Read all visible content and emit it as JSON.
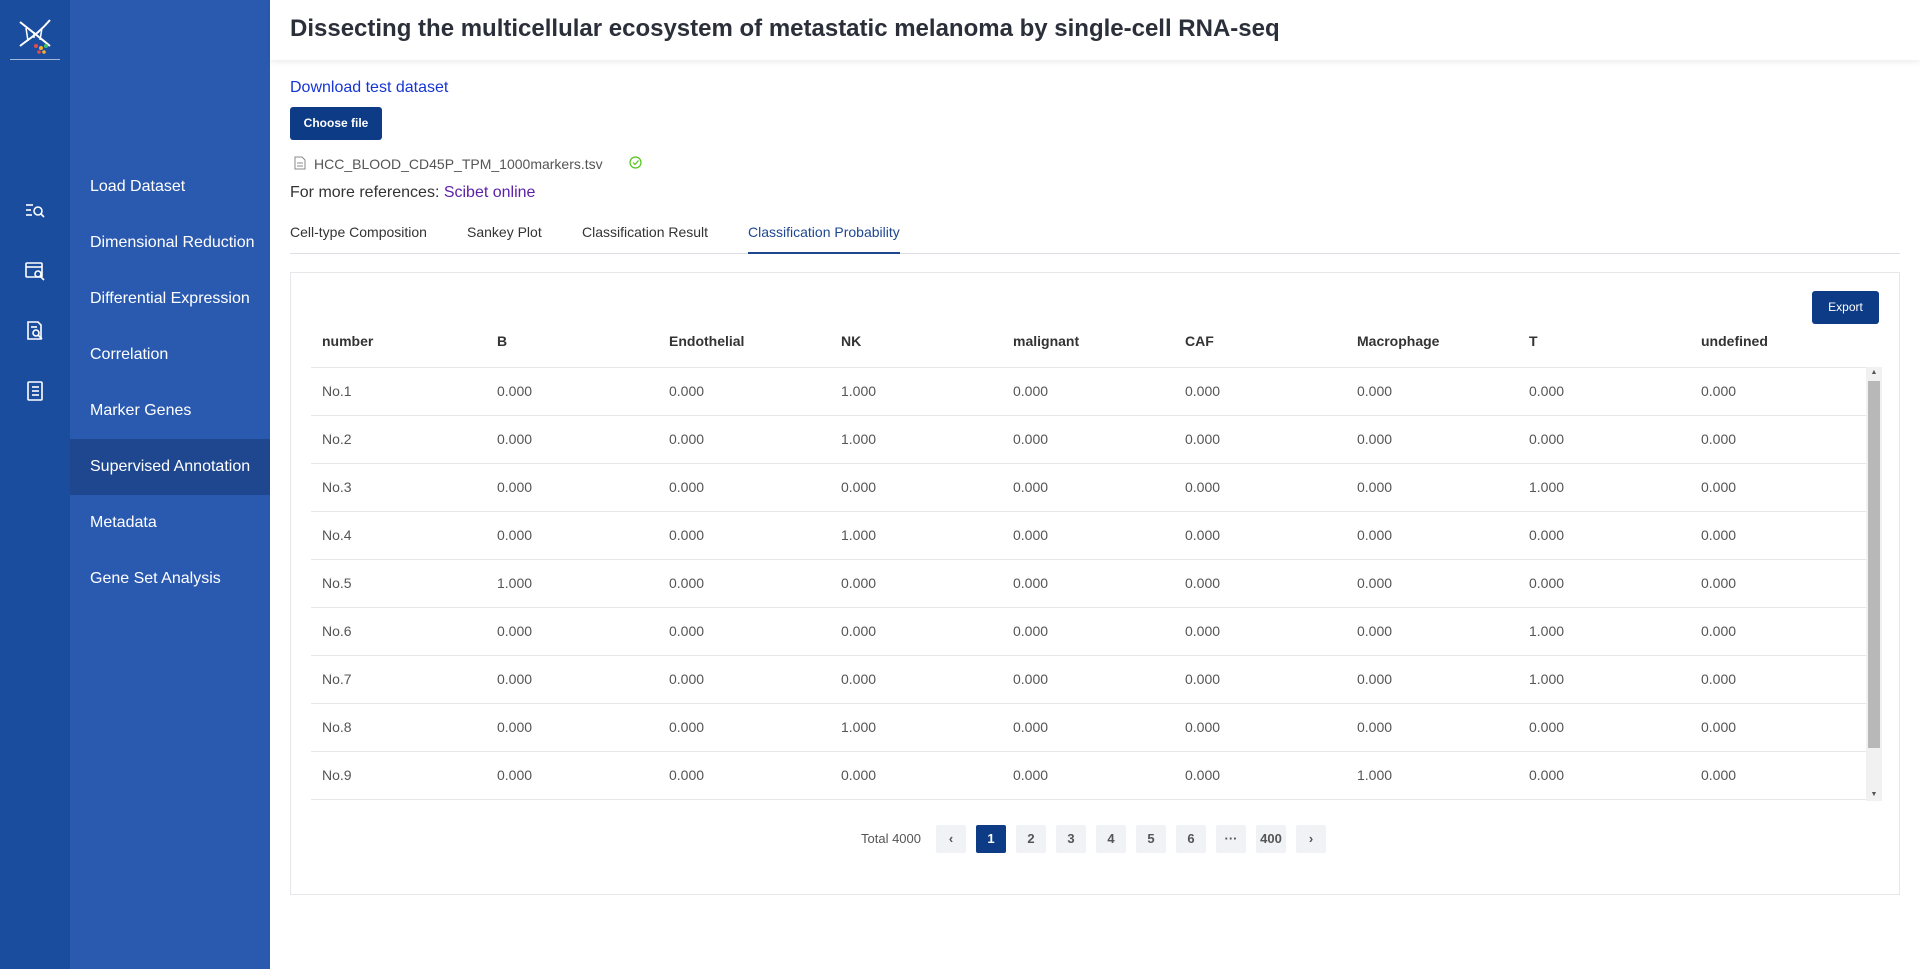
{
  "header": {
    "title": "Dissecting the multicellular ecosystem of metastatic melanoma by single-cell RNA-seq"
  },
  "rail": {
    "icons": [
      "dna-logo-icon",
      "search-list-icon",
      "browser-search-icon",
      "document-search-icon",
      "notebook-icon"
    ]
  },
  "nav": {
    "items": [
      {
        "label": "Load Dataset"
      },
      {
        "label": "Dimensional Reduction"
      },
      {
        "label": "Differential Expression"
      },
      {
        "label": "Correlation"
      },
      {
        "label": "Marker Genes"
      },
      {
        "label": "Supervised Annotation",
        "active": true
      },
      {
        "label": "Metadata"
      },
      {
        "label": "Gene Set Analysis"
      }
    ]
  },
  "upload": {
    "download_link": "Download test dataset",
    "choose_label": "Choose file",
    "file_name": "HCC_BLOOD_CD45P_TPM_1000markers.tsv",
    "refs_prefix": "For more references: ",
    "refs_link": "Scibet online"
  },
  "tabs": [
    {
      "label": "Cell-type Composition"
    },
    {
      "label": "Sankey Plot"
    },
    {
      "label": "Classification Result"
    },
    {
      "label": "Classification Probability",
      "active": true
    }
  ],
  "table": {
    "export_label": "Export",
    "columns": [
      "number",
      "B",
      "Endothelial",
      "NK",
      "malignant",
      "CAF",
      "Macrophage",
      "T",
      "undefined"
    ],
    "rows": [
      [
        "No.1",
        "0.000",
        "0.000",
        "1.000",
        "0.000",
        "0.000",
        "0.000",
        "0.000",
        "0.000"
      ],
      [
        "No.2",
        "0.000",
        "0.000",
        "1.000",
        "0.000",
        "0.000",
        "0.000",
        "0.000",
        "0.000"
      ],
      [
        "No.3",
        "0.000",
        "0.000",
        "0.000",
        "0.000",
        "0.000",
        "0.000",
        "1.000",
        "0.000"
      ],
      [
        "No.4",
        "0.000",
        "0.000",
        "1.000",
        "0.000",
        "0.000",
        "0.000",
        "0.000",
        "0.000"
      ],
      [
        "No.5",
        "1.000",
        "0.000",
        "0.000",
        "0.000",
        "0.000",
        "0.000",
        "0.000",
        "0.000"
      ],
      [
        "No.6",
        "0.000",
        "0.000",
        "0.000",
        "0.000",
        "0.000",
        "0.000",
        "1.000",
        "0.000"
      ],
      [
        "No.7",
        "0.000",
        "0.000",
        "0.000",
        "0.000",
        "0.000",
        "0.000",
        "1.000",
        "0.000"
      ],
      [
        "No.8",
        "0.000",
        "0.000",
        "1.000",
        "0.000",
        "0.000",
        "0.000",
        "0.000",
        "0.000"
      ],
      [
        "No.9",
        "0.000",
        "0.000",
        "0.000",
        "0.000",
        "0.000",
        "1.000",
        "0.000",
        "0.000"
      ]
    ]
  },
  "pagination": {
    "total_label": "Total 4000",
    "prev_icon": "‹",
    "next_icon": "›",
    "pages": [
      "1",
      "2",
      "3",
      "4",
      "5",
      "6",
      "···",
      "400"
    ],
    "current": "1"
  },
  "colors": {
    "rail": "#1a4d9e",
    "nav": "#2a5aaf",
    "nav_active": "#1e4790",
    "primary": "#0d3b86"
  }
}
